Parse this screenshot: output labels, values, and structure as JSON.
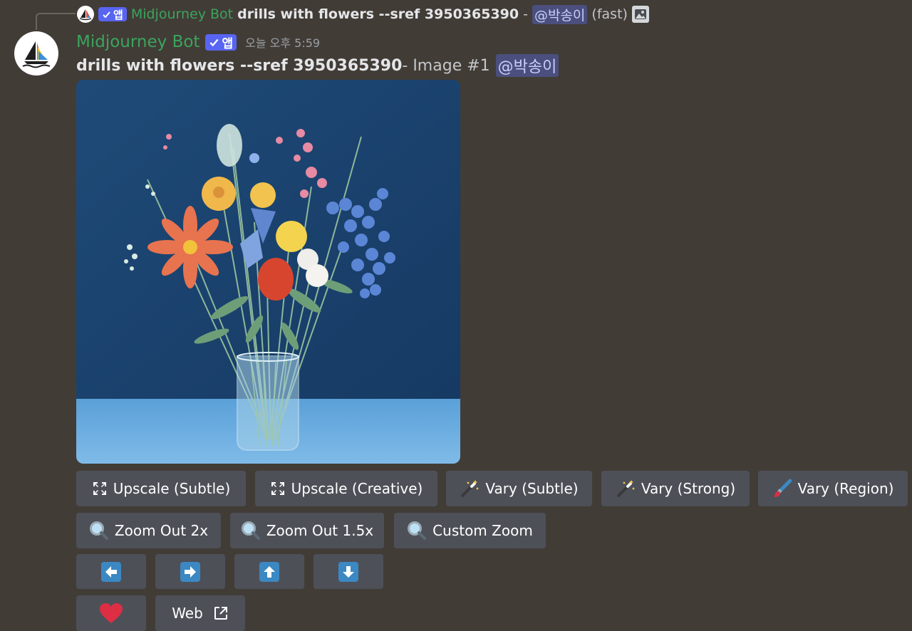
{
  "reply": {
    "author": "Midjourney Bot",
    "app_badge": "앱",
    "prompt": "drills with flowers --sref 3950365390",
    "separator": " - ",
    "mention": "@박송이",
    "mode": "(fast)",
    "image_icon": "image-icon"
  },
  "message": {
    "author": "Midjourney Bot",
    "app_badge": "앱",
    "timestamp": "오늘 오후 5:59",
    "prompt": "drills with flowers --sref 3950365390",
    "image_label": " - Image #1",
    "mention": "@박송이"
  },
  "buttons": {
    "upscale_subtle": "Upscale (Subtle)",
    "upscale_creative": "Upscale (Creative)",
    "vary_subtle": "Vary (Subtle)",
    "vary_strong": "Vary (Strong)",
    "vary_region": "Vary (Region)",
    "zoom_out_2x": "Zoom Out 2x",
    "zoom_out_1_5x": "Zoom Out 1.5x",
    "custom_zoom": "Custom Zoom",
    "web": "Web"
  },
  "icons": {
    "upscale": "expand-icon",
    "vary": "magic-wand-icon",
    "region": "paintbrush-icon",
    "zoom": "magnifier-icon",
    "pan": [
      "arrow-left-icon",
      "arrow-right-icon",
      "arrow-up-icon",
      "arrow-down-icon"
    ],
    "like": "heart-icon",
    "external": "external-link-icon"
  },
  "colors": {
    "background": "#423c37",
    "button": "#4e5058",
    "author": "#3aa55c",
    "badge": "#5865f2",
    "mention_bg": "#4b4f7e",
    "arrow_blue": "#3b88c3",
    "heart": "#dd2e44"
  }
}
